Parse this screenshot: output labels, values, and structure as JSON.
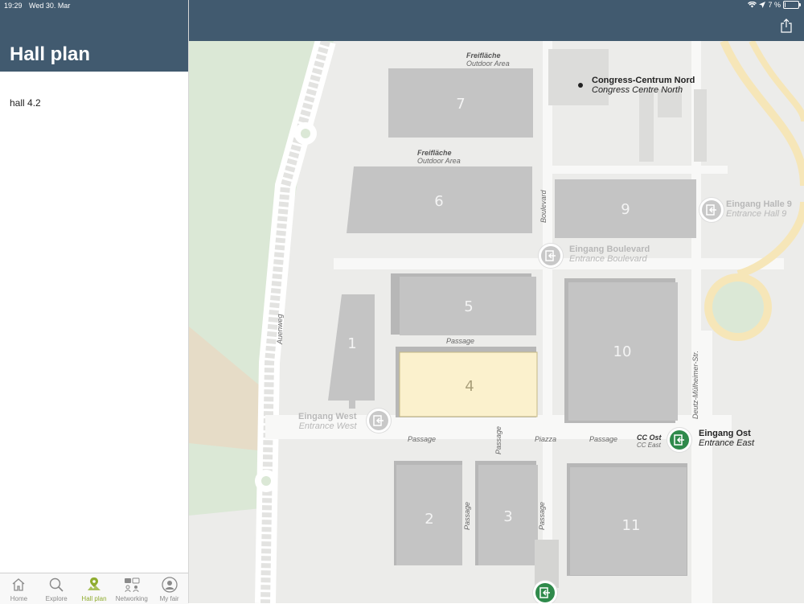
{
  "status": {
    "time": "19:29",
    "date": "Wed 30. Mar",
    "battery": "7 %",
    "battery_level": 0.07
  },
  "left": {
    "title": "Hall plan",
    "selected_hall": "hall 4.2"
  },
  "tabs": [
    {
      "label": "Home",
      "icon": "home-icon",
      "active": false
    },
    {
      "label": "Explore",
      "icon": "search-icon",
      "active": false
    },
    {
      "label": "Hall plan",
      "icon": "map-pin-icon",
      "active": true
    },
    {
      "label": "Networking",
      "icon": "networking-icon",
      "active": false
    },
    {
      "label": "My fair",
      "icon": "person-icon",
      "active": false
    }
  ],
  "map": {
    "halls": [
      "7",
      "6",
      "9",
      "5",
      "1",
      "4",
      "10",
      "2",
      "3",
      "11"
    ],
    "highlighted_hall": "4",
    "highlight_color": "#fbf1cd",
    "poi": {
      "de": "Congress-Centrum Nord",
      "en": "Congress Centre North"
    },
    "outdoor_1": {
      "de": "Freifläche",
      "en": "Outdoor Area"
    },
    "outdoor_2": {
      "de": "Freifläche",
      "en": "Outdoor Area"
    },
    "entrances": {
      "hall9": {
        "de": "Eingang Halle 9",
        "en": "Entrance Hall 9"
      },
      "boulevard": {
        "de": "Eingang Boulevard",
        "en": "Entrance Boulevard"
      },
      "west": {
        "de": "Eingang West",
        "en": "Entrance West"
      },
      "east": {
        "de": "Eingang Ost",
        "en": "Entrance East"
      },
      "cc_east": {
        "de": "CC Ost",
        "en": "CC East"
      }
    },
    "streets": {
      "auenweg": "Auenweg",
      "boulevard": "Boulevard",
      "deutz": "Deutz-Mülheimer-Str.",
      "passage": "Passage",
      "piazza": "Piazza"
    },
    "colors": {
      "hall": "#c4c4c4",
      "background": "#ececea",
      "green_area": "#dbe8d6",
      "road": "#f6e6b8",
      "header": "#415a6f",
      "accent_green": "#2f8a4b"
    }
  }
}
